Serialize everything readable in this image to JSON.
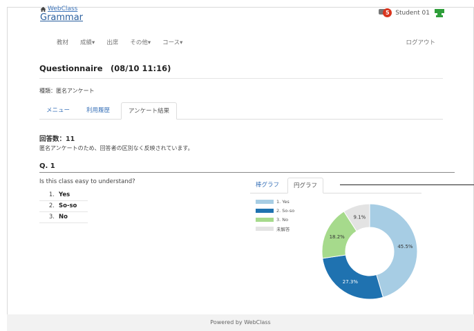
{
  "header": {
    "site_name": "WebClass",
    "course_title": "Grammar",
    "notification_count": "5",
    "user_name": "Student 01"
  },
  "nav": {
    "items": [
      "教材",
      "成績▾",
      "出席",
      "その他▾",
      "コース▾"
    ],
    "logout": "ログアウト"
  },
  "page": {
    "title": "Questionnaire　(08/10 11:16)",
    "type_line": "種類：匿名アンケート",
    "tabs": [
      "メニュー",
      "利用履歴",
      "アンケート結果"
    ],
    "active_tab": "アンケート結果",
    "answer_count": "回答数：11",
    "anon_note": "匿名アンケートのため、回答者の区別なく反映されています。"
  },
  "question": {
    "number": "Q. 1",
    "text": "Is this class easy to understand?",
    "options": [
      {
        "num": "1.",
        "label": "Yes"
      },
      {
        "num": "2.",
        "label": "So-so"
      },
      {
        "num": "3.",
        "label": "No"
      }
    ],
    "chart_tabs": [
      "棒グラフ",
      "円グラフ"
    ],
    "active_chart_tab": "円グラフ"
  },
  "colors": {
    "accent_link": "#3b73b9",
    "badge": "#d9351e",
    "user_icon": "#2e9e3a"
  },
  "chart_data": {
    "type": "pie",
    "style": "donut",
    "categories": [
      "1. Yes",
      "2. So-so",
      "3. No",
      "未解答"
    ],
    "values": [
      45.5,
      27.3,
      18.2,
      9.1
    ],
    "value_labels": [
      "45.5%",
      "27.3%",
      "18.2%",
      "9.1%"
    ],
    "colors": [
      "#a7cde4",
      "#1f72b0",
      "#a6da8c",
      "#e3e3e3"
    ],
    "legend_position": "left"
  },
  "footer": {
    "text": "Powered by WebClass"
  }
}
